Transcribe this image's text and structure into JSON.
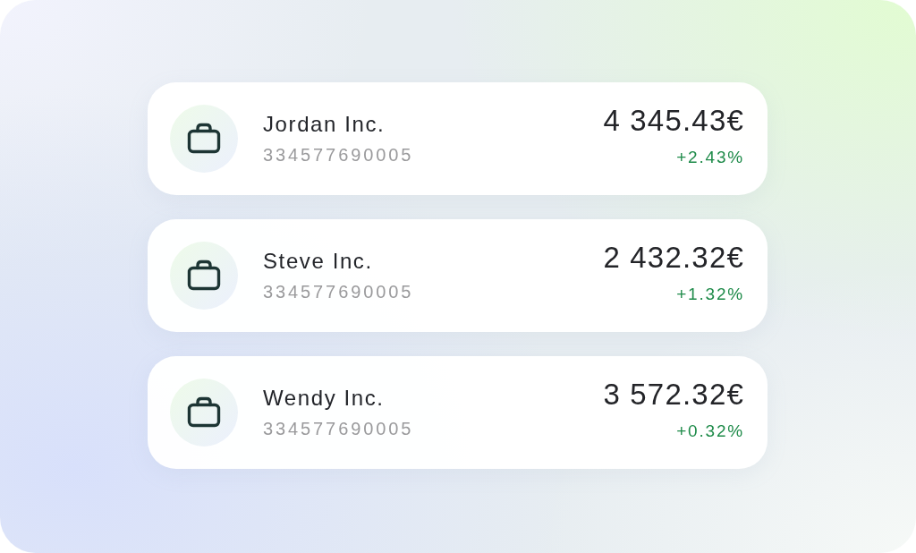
{
  "accounts": [
    {
      "name": "Jordan Inc.",
      "number": "334577690005",
      "amount": "4 345.43€",
      "change": "+2.43%"
    },
    {
      "name": "Steve Inc.",
      "number": "334577690005",
      "amount": "2 432.32€",
      "change": "+1.32%"
    },
    {
      "name": "Wendy Inc.",
      "number": "334577690005",
      "amount": "3 572.32€",
      "change": "+0.32%"
    }
  ]
}
